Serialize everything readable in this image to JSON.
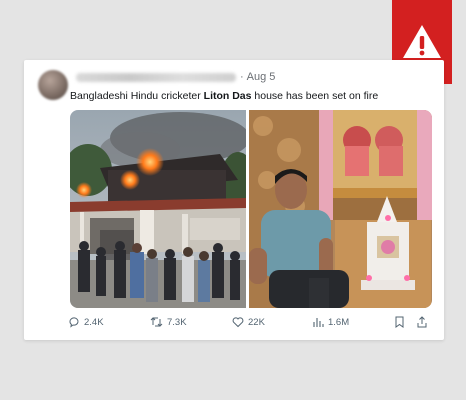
{
  "warning": {
    "icon": "warning-triangle-icon",
    "color": "#d32020"
  },
  "tweet": {
    "date": "Aug 5",
    "dot": "·",
    "text_before": "Bangladeshi Hindu cricketer ",
    "text_bold": "Liton Das",
    "text_after": " house has been set on fire",
    "images": [
      {
        "icon": "burning-house-photo"
      },
      {
        "icon": "man-sitting-near-shrine-photo"
      }
    ],
    "actions": {
      "replies": "2.4K",
      "retweets": "7.3K",
      "likes": "22K",
      "views": "1.6M"
    }
  }
}
